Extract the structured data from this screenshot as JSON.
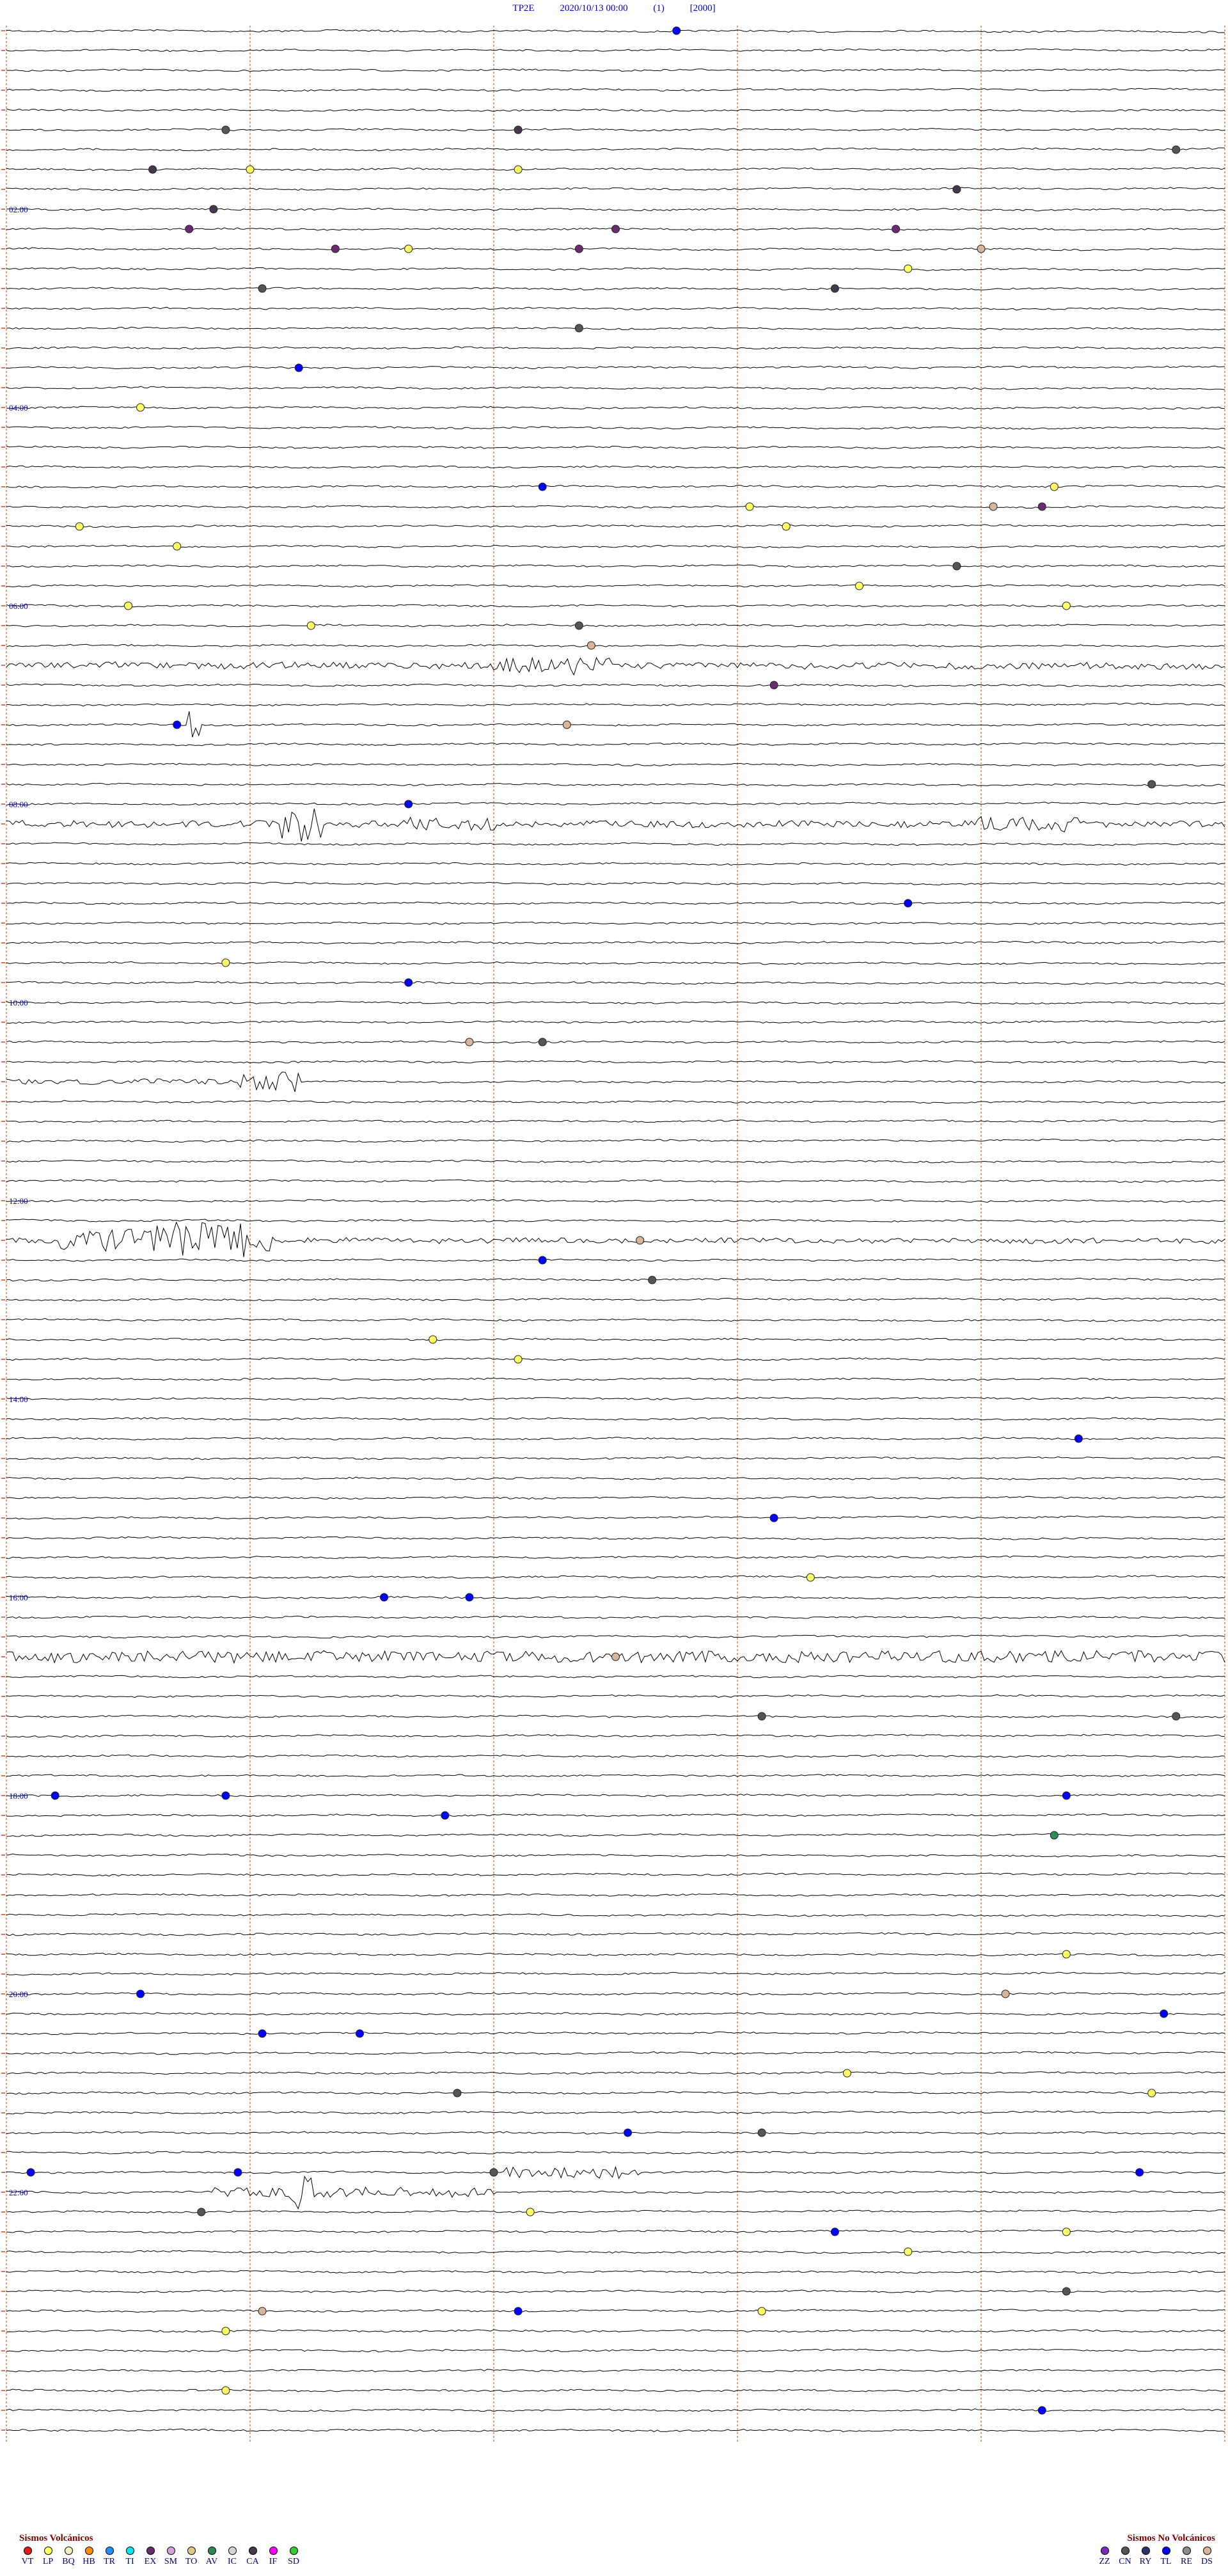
{
  "header": {
    "station": "TP2E",
    "datetime": "2020/10/13 00:00",
    "channel": "(1)",
    "scale": "[2000]"
  },
  "time_labels": [
    "02:00",
    "04:00",
    "06:00",
    "08:00",
    "10:00",
    "12:00",
    "14:00",
    "16:00",
    "18:00",
    "20:00",
    "22:00"
  ],
  "colors": {
    "trace": "#000000",
    "gridline": "#e07a4a",
    "label": "#0000cc",
    "VT": "#e41a1c",
    "LP": "#ffff66",
    "BQ": "#f2efc0",
    "HB": "#ff8c00",
    "TR": "#1e90ff",
    "TI": "#00e5ee",
    "EX": "#6a2c70",
    "SM": "#d8a0d8",
    "TO": "#e0c88a",
    "AV": "#2e8b57",
    "IC": "#d3d3d3",
    "CA": "#44384d",
    "IF": "#ff00ff",
    "SD": "#32cd32",
    "ZZ": "#7b2cbf",
    "CN": "#555555",
    "RY": "#2f2f6f",
    "TL": "#0000ff",
    "RE": "#8c8c8c",
    "DS": "#d8b49b"
  },
  "legend": {
    "volcanic_title": "Sismos Volcánicos",
    "volcanic": [
      "VT",
      "LP",
      "BQ",
      "HB",
      "TR",
      "TI",
      "EX",
      "SM",
      "TO",
      "AV",
      "IC",
      "CA",
      "IF",
      "SD"
    ],
    "non_volcanic_title": "Sismos No Volcánicos",
    "non_volcanic": [
      "ZZ",
      "CN",
      "RY",
      "TL",
      "RE",
      "DS"
    ]
  },
  "events": [
    {
      "row": 0,
      "t": 0.55,
      "type": "TL"
    },
    {
      "row": 5,
      "t": 0.18,
      "type": "CN"
    },
    {
      "row": 5,
      "t": 0.42,
      "type": "CA"
    },
    {
      "row": 6,
      "t": 0.96,
      "type": "CN"
    },
    {
      "row": 7,
      "t": 0.12,
      "type": "CA"
    },
    {
      "row": 7,
      "t": 0.2,
      "type": "LP"
    },
    {
      "row": 7,
      "t": 0.42,
      "type": "LP"
    },
    {
      "row": 8,
      "t": 0.78,
      "type": "CA"
    },
    {
      "row": 9,
      "t": 0.17,
      "type": "CA"
    },
    {
      "row": 10,
      "t": 0.15,
      "type": "EX"
    },
    {
      "row": 10,
      "t": 0.5,
      "type": "EX"
    },
    {
      "row": 10,
      "t": 0.73,
      "type": "EX"
    },
    {
      "row": 11,
      "t": 0.27,
      "type": "EX"
    },
    {
      "row": 11,
      "t": 0.33,
      "type": "LP"
    },
    {
      "row": 11,
      "t": 0.47,
      "type": "EX"
    },
    {
      "row": 11,
      "t": 0.8,
      "type": "DS"
    },
    {
      "row": 12,
      "t": 0.74,
      "type": "LP"
    },
    {
      "row": 13,
      "t": 0.21,
      "type": "CN"
    },
    {
      "row": 13,
      "t": 0.68,
      "type": "CA"
    },
    {
      "row": 15,
      "t": 0.47,
      "type": "CN"
    },
    {
      "row": 17,
      "t": 0.24,
      "type": "TL"
    },
    {
      "row": 19,
      "t": 0.11,
      "type": "LP"
    },
    {
      "row": 23,
      "t": 0.44,
      "type": "TL"
    },
    {
      "row": 23,
      "t": 0.86,
      "type": "LP"
    },
    {
      "row": 24,
      "t": 0.61,
      "type": "LP"
    },
    {
      "row": 24,
      "t": 0.81,
      "type": "DS"
    },
    {
      "row": 24,
      "t": 0.85,
      "type": "EX"
    },
    {
      "row": 25,
      "t": 0.06,
      "type": "LP"
    },
    {
      "row": 25,
      "t": 0.64,
      "type": "LP"
    },
    {
      "row": 26,
      "t": 0.14,
      "type": "LP"
    },
    {
      "row": 27,
      "t": 0.78,
      "type": "CN"
    },
    {
      "row": 28,
      "t": 0.7,
      "type": "LP"
    },
    {
      "row": 29,
      "t": 0.1,
      "type": "LP"
    },
    {
      "row": 29,
      "t": 0.87,
      "type": "LP"
    },
    {
      "row": 30,
      "t": 0.25,
      "type": "LP"
    },
    {
      "row": 30,
      "t": 0.47,
      "type": "CN"
    },
    {
      "row": 31,
      "t": 0.48,
      "type": "DS"
    },
    {
      "row": 33,
      "t": 0.63,
      "type": "EX"
    },
    {
      "row": 35,
      "t": 0.46,
      "type": "DS"
    },
    {
      "row": 35,
      "t": 0.14,
      "type": "TL"
    },
    {
      "row": 38,
      "t": 0.94,
      "type": "CN"
    },
    {
      "row": 39,
      "t": 0.33,
      "type": "TL"
    },
    {
      "row": 44,
      "t": 0.74,
      "type": "TL"
    },
    {
      "row": 47,
      "t": 0.18,
      "type": "LP"
    },
    {
      "row": 48,
      "t": 0.33,
      "type": "TL"
    },
    {
      "row": 51,
      "t": 0.38,
      "type": "DS"
    },
    {
      "row": 51,
      "t": 0.44,
      "type": "CN"
    },
    {
      "row": 61,
      "t": 0.52,
      "type": "DS"
    },
    {
      "row": 62,
      "t": 0.44,
      "type": "TL"
    },
    {
      "row": 63,
      "t": 0.53,
      "type": "CN"
    },
    {
      "row": 66,
      "t": 0.35,
      "type": "LP"
    },
    {
      "row": 67,
      "t": 0.42,
      "type": "LP"
    },
    {
      "row": 71,
      "t": 0.88,
      "type": "TL"
    },
    {
      "row": 75,
      "t": 0.63,
      "type": "TL"
    },
    {
      "row": 78,
      "t": 0.66,
      "type": "LP"
    },
    {
      "row": 79,
      "t": 0.31,
      "type": "TL"
    },
    {
      "row": 79,
      "t": 0.38,
      "type": "TL"
    },
    {
      "row": 82,
      "t": 0.5,
      "type": "DS"
    },
    {
      "row": 85,
      "t": 0.62,
      "type": "CN"
    },
    {
      "row": 85,
      "t": 0.96,
      "type": "CN"
    },
    {
      "row": 89,
      "t": 0.04,
      "type": "TL"
    },
    {
      "row": 89,
      "t": 0.18,
      "type": "TL"
    },
    {
      "row": 89,
      "t": 0.87,
      "type": "TL"
    },
    {
      "row": 90,
      "t": 0.36,
      "type": "TL"
    },
    {
      "row": 91,
      "t": 0.86,
      "type": "AV"
    },
    {
      "row": 97,
      "t": 0.87,
      "type": "LP"
    },
    {
      "row": 99,
      "t": 0.11,
      "type": "TL"
    },
    {
      "row": 99,
      "t": 0.82,
      "type": "DS"
    },
    {
      "row": 100,
      "t": 0.95,
      "type": "TL"
    },
    {
      "row": 101,
      "t": 0.21,
      "type": "TL"
    },
    {
      "row": 101,
      "t": 0.29,
      "type": "TL"
    },
    {
      "row": 103,
      "t": 0.69,
      "type": "LP"
    },
    {
      "row": 104,
      "t": 0.37,
      "type": "CN"
    },
    {
      "row": 104,
      "t": 0.94,
      "type": "LP"
    },
    {
      "row": 106,
      "t": 0.51,
      "type": "TL"
    },
    {
      "row": 106,
      "t": 0.62,
      "type": "CN"
    },
    {
      "row": 108,
      "t": 0.02,
      "type": "TL"
    },
    {
      "row": 108,
      "t": 0.19,
      "type": "TL"
    },
    {
      "row": 108,
      "t": 0.4,
      "type": "CN"
    },
    {
      "row": 108,
      "t": 0.93,
      "type": "TL"
    },
    {
      "row": 110,
      "t": 0.16,
      "type": "CN"
    },
    {
      "row": 110,
      "t": 0.43,
      "type": "LP"
    },
    {
      "row": 111,
      "t": 0.68,
      "type": "TL"
    },
    {
      "row": 111,
      "t": 0.87,
      "type": "LP"
    },
    {
      "row": 112,
      "t": 0.74,
      "type": "LP"
    },
    {
      "row": 114,
      "t": 0.87,
      "type": "CN"
    },
    {
      "row": 115,
      "t": 0.21,
      "type": "DS"
    },
    {
      "row": 115,
      "t": 0.42,
      "type": "TL"
    },
    {
      "row": 115,
      "t": 0.62,
      "type": "LP"
    },
    {
      "row": 116,
      "t": 0.18,
      "type": "LP"
    },
    {
      "row": 119,
      "t": 0.18,
      "type": "LP"
    },
    {
      "row": 120,
      "t": 0.85,
      "type": "TL"
    }
  ],
  "bursts": [
    {
      "row": 32,
      "t0": 0.0,
      "t1": 1.0,
      "amp": 5
    },
    {
      "row": 32,
      "t0": 0.4,
      "t1": 0.5,
      "amp": 14
    },
    {
      "row": 40,
      "t0": 0.0,
      "t1": 1.0,
      "amp": 5
    },
    {
      "row": 40,
      "t0": 0.22,
      "t1": 0.26,
      "amp": 28
    },
    {
      "row": 40,
      "t0": 0.33,
      "t1": 0.4,
      "amp": 10
    },
    {
      "row": 40,
      "t0": 0.79,
      "t1": 0.89,
      "amp": 12
    },
    {
      "row": 35,
      "t0": 0.15,
      "t1": 0.16,
      "amp": 24
    },
    {
      "row": 53,
      "t0": 0.0,
      "t1": 0.24,
      "amp": 4
    },
    {
      "row": 53,
      "t0": 0.19,
      "t1": 0.24,
      "amp": 16
    },
    {
      "row": 61,
      "t0": 0.0,
      "t1": 1.0,
      "amp": 4
    },
    {
      "row": 61,
      "t0": 0.04,
      "t1": 0.22,
      "amp": 18
    },
    {
      "row": 61,
      "t0": 0.12,
      "t1": 0.2,
      "amp": 28
    },
    {
      "row": 82,
      "t0": 0.0,
      "t1": 1.0,
      "amp": 9
    },
    {
      "row": 108,
      "t0": 0.41,
      "t1": 0.52,
      "amp": 9
    },
    {
      "row": 109,
      "t0": 0.17,
      "t1": 0.4,
      "amp": 8
    },
    {
      "row": 109,
      "t0": 0.23,
      "t1": 0.25,
      "amp": 26
    }
  ]
}
